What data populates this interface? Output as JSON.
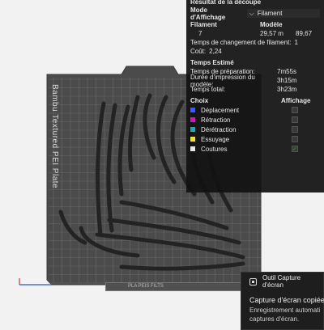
{
  "panel": {
    "title": "Résultat de la découpe",
    "mode_label": "Mode d'Affichage",
    "mode_value": "Filament",
    "filament_header": "Filament",
    "model_header": "Modèle",
    "filament_row": {
      "id": "7",
      "length": "29,57 m",
      "weight": "89,67"
    },
    "change_time_label": "Temps de changement de filament:",
    "change_time_value": "1",
    "cost_label": "Coût:",
    "cost_value": "2,24",
    "estimated_title": "Temps Estimé",
    "prep_label": "Temps de préparation:",
    "prep_value": "7m55s",
    "print_label": "Durée d'impression du modèle:",
    "print_value": "3h15m",
    "total_label": "Temps total:",
    "total_value": "3h23m",
    "choice_header": "Choix",
    "display_header": "Affichage",
    "legend": [
      {
        "label": "Déplacement",
        "color": "#3d5afe",
        "checked": false
      },
      {
        "label": "Rétraction",
        "color": "#c51db9",
        "checked": false
      },
      {
        "label": "Dérétraction",
        "color": "#22a6b3",
        "checked": false
      },
      {
        "label": "Essuyage",
        "color": "#f6e60d",
        "checked": false
      },
      {
        "label": "Coutures",
        "color": "#e8e8e8",
        "checked": true
      }
    ]
  },
  "plate": {
    "name": "Bambu Textured PEI Plate",
    "label_strip": "PLA PEIS FILTS"
  },
  "toast": {
    "app": "Outil Capture d'écran",
    "title": "Capture d'écran copiée d",
    "line1": "Enregistrement automati",
    "line2": "captures d'écran."
  },
  "colors": {
    "plate": "#4b4b4b",
    "grid": "#6a6a6a",
    "print": "#232323",
    "panel_bg": "#121212",
    "check": "#2ea043"
  }
}
